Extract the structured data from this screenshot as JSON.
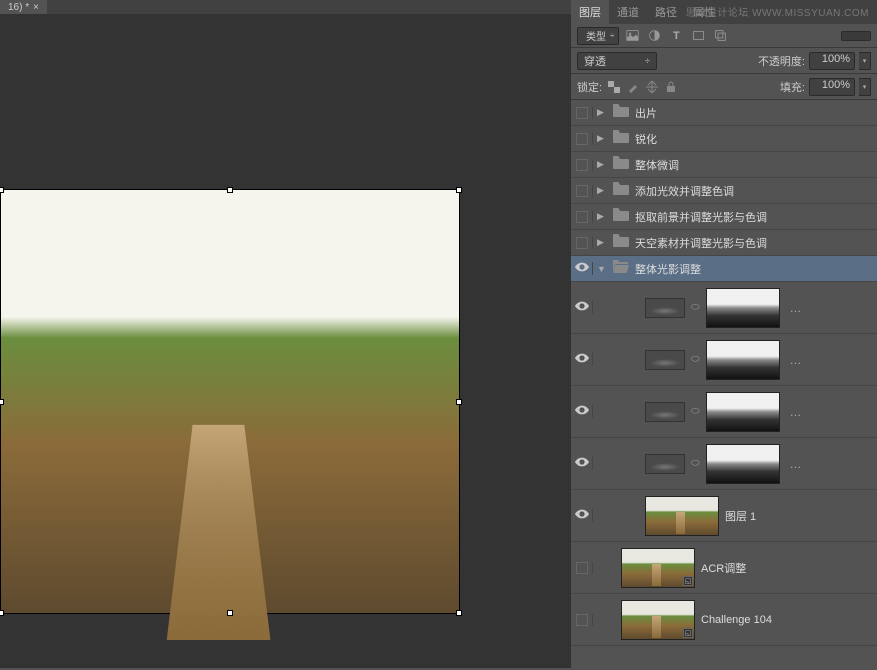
{
  "tab": {
    "title": "16) *",
    "close": "×"
  },
  "panel_tabs": {
    "layers": "图层",
    "channels": "通道",
    "paths": "路径",
    "properties": "属性"
  },
  "watermark": "思维设计论坛 WWW.MISSYUAN.COM",
  "filter": {
    "type": "类型",
    "T": "T"
  },
  "blend": {
    "mode": "穿透",
    "opacity_label": "不透明度:",
    "opacity_value": "100%"
  },
  "lock": {
    "label": "锁定:",
    "fill_label": "填充:",
    "fill_value": "100%"
  },
  "groups": {
    "g1": "出片",
    "g2": "锐化",
    "g3": "整体微调",
    "g4": "添加光效并调整色调",
    "g5": "抠取前景并调整光影与色调",
    "g6": "天空素材并调整光影与色调",
    "g7": "整体光影调整"
  },
  "layers": {
    "l1": "图层 1",
    "l2": "ACR调整",
    "l3": "Challenge 104"
  },
  "arrows": {
    "right": "▶",
    "down": "▼",
    "dd": "÷"
  },
  "icons": {
    "search": "🔍",
    "dots": "…"
  }
}
